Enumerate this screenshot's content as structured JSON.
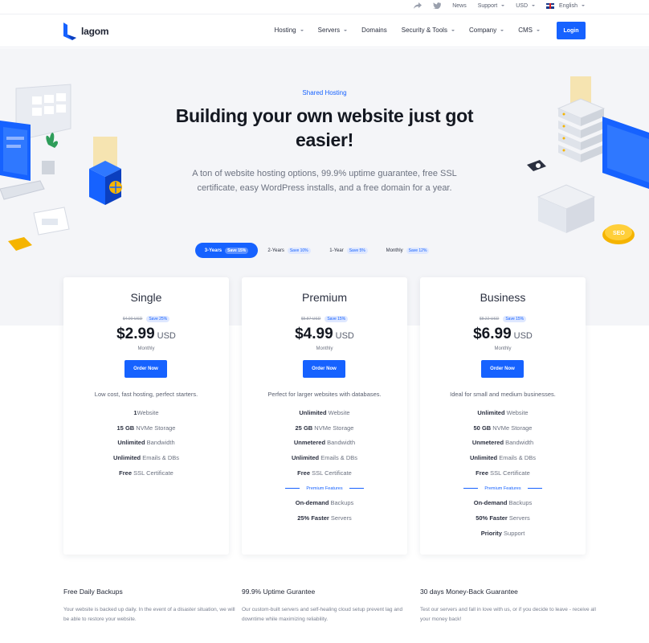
{
  "topbar": {
    "news": "News",
    "support": "Support",
    "currency": "USD",
    "language": "English"
  },
  "nav": {
    "logo": "lagom",
    "items": [
      {
        "label": "Hosting",
        "dropdown": true
      },
      {
        "label": "Servers",
        "dropdown": true
      },
      {
        "label": "Domains",
        "dropdown": false
      },
      {
        "label": "Security & Tools",
        "dropdown": true
      },
      {
        "label": "Company",
        "dropdown": true
      },
      {
        "label": "CMS",
        "dropdown": true
      }
    ],
    "login": "Login"
  },
  "hero": {
    "tag": "Shared Hosting",
    "title": "Building your own website just got easier!",
    "subtitle": "A ton of website hosting options, 99.9% uptime guarantee, free SSL certificate, easy WordPress installs, and a free domain for a year."
  },
  "billing": [
    {
      "label": "3-Years",
      "save": "Save 15%",
      "active": true
    },
    {
      "label": "2-Years",
      "save": "Save 10%",
      "active": false
    },
    {
      "label": "1-Year",
      "save": "Save 5%",
      "active": false
    },
    {
      "label": "Monthly",
      "save": "Save 12%",
      "active": false
    }
  ],
  "plans": [
    {
      "name": "Single",
      "old_price": "$4.00 USD",
      "save": "Save 25%",
      "price": "$2.99",
      "currency": "USD",
      "period": "Monthly",
      "order": "Order Now",
      "desc": "Low cost, fast hosting, perfect starters.",
      "features": [
        {
          "bold": "1",
          "text": "Website"
        },
        {
          "bold": "15 GB",
          "text": " NVMe Storage"
        },
        {
          "bold": "Unlimited",
          "text": " Bandwidth"
        },
        {
          "bold": "Unlimited",
          "text": " Emails & DBs"
        },
        {
          "bold": "Free",
          "text": " SSL Certificate"
        }
      ]
    },
    {
      "name": "Premium",
      "old_price": "$5.87 USD",
      "save": "Save 15%",
      "price": "$4.99",
      "currency": "USD",
      "period": "Monthly",
      "order": "Order Now",
      "desc": "Perfect for larger websites with databases.",
      "features": [
        {
          "bold": "Unlimited",
          "text": " Website"
        },
        {
          "bold": "25 GB",
          "text": " NVMe Storage"
        },
        {
          "bold": "Unmetered",
          "text": " Bandwidth"
        },
        {
          "bold": "Unlimited",
          "text": " Emails & DBs"
        },
        {
          "bold": "Free",
          "text": " SSL Certificate"
        }
      ],
      "premium_label": "Premium Features",
      "premium": [
        {
          "bold": "On-demand",
          "text": " Backups"
        },
        {
          "bold": "25% Faster",
          "text": " Servers"
        }
      ]
    },
    {
      "name": "Business",
      "old_price": "$8.22 USD",
      "save": "Save 15%",
      "price": "$6.99",
      "currency": "USD",
      "period": "Monthly",
      "order": "Order Now",
      "desc": "Ideal for small and medium businesses.",
      "features": [
        {
          "bold": "Unlimited",
          "text": " Website"
        },
        {
          "bold": "50 GB",
          "text": " NVMe Storage"
        },
        {
          "bold": "Unmetered",
          "text": " Bandwidth"
        },
        {
          "bold": "Unlimited",
          "text": " Emails & DBs"
        },
        {
          "bold": "Free",
          "text": " SSL Certificate"
        }
      ],
      "premium_label": "Premium Features",
      "premium": [
        {
          "bold": "On-demand",
          "text": " Backups"
        },
        {
          "bold": "50% Faster",
          "text": " Servers"
        },
        {
          "bold": "Priority",
          "text": " Support"
        }
      ]
    }
  ],
  "info": [
    {
      "title": "Free Daily Backups",
      "text": "Your website is backed up daily. In the event of a disaster situation, we will be able to restore your website."
    },
    {
      "title": "99.9% Uptime Gurantee",
      "text": "Our custom-built servers and self-healing cloud setup prevent lag and downtime while maximizing reliability."
    },
    {
      "title": "30 days Money-Back Guarantee",
      "text": "Test our servers and fall in love with us, or if you decide to leave - receive all your money back!"
    }
  ],
  "colors": {
    "accent": "#1662ff",
    "hero_bg": "#f4f5f8",
    "gold": "#f5b400"
  }
}
